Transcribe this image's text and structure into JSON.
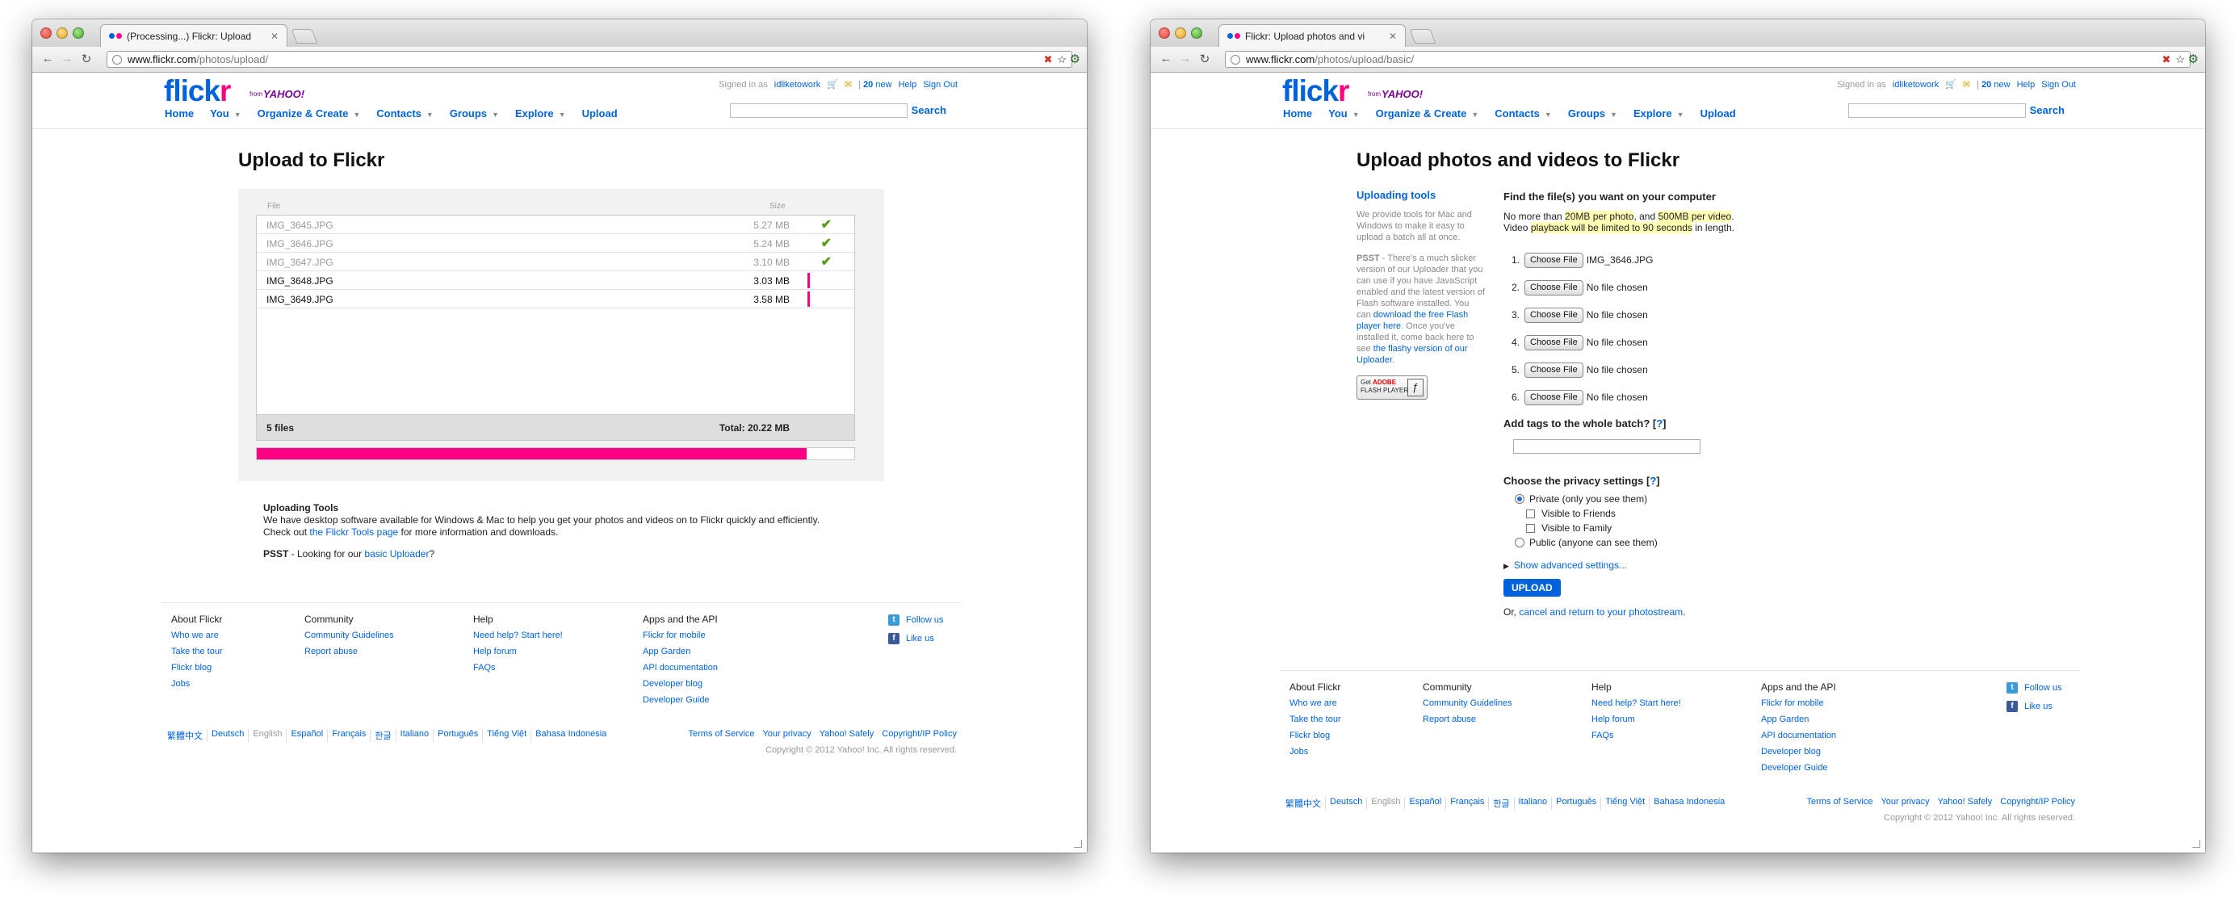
{
  "common": {
    "signed_in_as": "Signed in as",
    "username": "idliketowork",
    "mail_count": "20",
    "mail_new": " new",
    "help": "Help",
    "sign_out": "Sign Out",
    "search_label": "Search",
    "logo_flick": "flick",
    "logo_r": "r",
    "logo_from": "from",
    "logo_yahoo": "YAHOO!",
    "nav": [
      "Home",
      "You",
      "Organize & Create",
      "Contacts",
      "Groups",
      "Explore",
      "Upload"
    ],
    "footer": {
      "columns": [
        {
          "title": "About Flickr",
          "links": [
            "Who we are",
            "Take the tour",
            "Flickr blog",
            "Jobs"
          ]
        },
        {
          "title": "Community",
          "links": [
            "Community Guidelines",
            "Report abuse"
          ]
        },
        {
          "title": "Help",
          "links": [
            "Need help? Start here!",
            "Help forum",
            "FAQs"
          ]
        },
        {
          "title": "Apps and the API",
          "links": [
            "Flickr for mobile",
            "App Garden",
            "API documentation",
            "Developer blog",
            "Developer Guide"
          ]
        }
      ],
      "social": [
        "Follow us",
        "Like us"
      ],
      "languages": [
        "繁體中文",
        "Deutsch",
        "English",
        "Español",
        "Français",
        "한글",
        "Italiano",
        "Português",
        "Tiếng Việt",
        "Bahasa Indonesia"
      ],
      "legal": [
        "Terms of Service",
        "Your privacy",
        "Yahoo! Safely",
        "Copyright/IP Policy"
      ],
      "copyright": "Copyright © 2012 Yahoo! Inc. All rights reserved."
    }
  },
  "left": {
    "tab_title": "(Processing...) Flickr: Upload",
    "url_host": "www.flickr.com",
    "url_path": "/photos/upload/",
    "title": "Upload to Flickr",
    "col_file": "File",
    "col_size": "Size",
    "files": [
      {
        "name": "IMG_3645.JPG",
        "size": "5.27 MB",
        "status": "done"
      },
      {
        "name": "IMG_3646.JPG",
        "size": "5.24 MB",
        "status": "done"
      },
      {
        "name": "IMG_3647.JPG",
        "size": "3.10 MB",
        "status": "done"
      },
      {
        "name": "IMG_3648.JPG",
        "size": "3.03 MB",
        "status": "active"
      },
      {
        "name": "IMG_3649.JPG",
        "size": "3.58 MB",
        "status": "active"
      }
    ],
    "file_count": "5 files",
    "total": "Total: 20.22 MB",
    "progress_fraction": 0.92,
    "tools_heading": "Uploading Tools",
    "tools_text": "We have desktop software available for Windows & Mac to help you get your photos and videos on to Flickr quickly and efficiently.",
    "tools_checkout": "Check out ",
    "tools_link": "the Flickr Tools page",
    "tools_after": " for more information and downloads.",
    "psst_label": "PSST",
    "psst_text": " - Looking for our ",
    "psst_link": "basic Uploader",
    "psst_end": "?"
  },
  "right": {
    "tab_title": "Flickr: Upload photos and vi",
    "url_host": "www.flickr.com",
    "url_path": "/photos/upload/basic/",
    "title": "Upload photos and videos to Flickr",
    "sidebar_heading": "Uploading tools",
    "sidebar_p1": "We provide tools for Mac and Windows to make it easy to upload a batch all at once.",
    "sidebar_psst": "PSST",
    "sidebar_p2a": " - There's a much slicker version of our Uploader that you can use if you have JavaScript enabled and the latest version of Flash software installed. You can ",
    "sidebar_link1": "download the free Flash player here",
    "sidebar_p2b": ". Once you've installed it, come back here to see ",
    "sidebar_link2": "the flashy version of our Uploader",
    "sidebar_p2c": ".",
    "flash_get": "Get",
    "flash_adobe": "ADOBE",
    "flash_player": "FLASH PLAYER",
    "find_heading": "Find the file(s) you want on your computer",
    "limit_1": "No more than ",
    "limit_2": "20MB per photo",
    "limit_3": ", and ",
    "limit_4": "500MB per video",
    "limit_5": ".",
    "limit_6": "Video ",
    "limit_7": "playback will be limited to 90 seconds",
    "limit_8": " in length.",
    "choose_label": "Choose File",
    "file_slots": [
      {
        "num": "1.",
        "value": "IMG_3646.JPG"
      },
      {
        "num": "2.",
        "value": "No file chosen"
      },
      {
        "num": "3.",
        "value": "No file chosen"
      },
      {
        "num": "4.",
        "value": "No file chosen"
      },
      {
        "num": "5.",
        "value": "No file chosen"
      },
      {
        "num": "6.",
        "value": "No file chosen"
      }
    ],
    "tags_heading": "Add tags to the whole batch? [",
    "tags_q": "?",
    "tags_close": "]",
    "privacy_heading": "Choose the privacy settings [",
    "privacy_q": "?",
    "privacy_close": "]",
    "privacy_options": [
      "Private (only you see them)",
      "Visible to Friends",
      "Visible to Family",
      "Public (anyone can see them)"
    ],
    "advanced": "Show advanced settings...",
    "upload_button": "UPLOAD",
    "cancel_prefix": "Or, ",
    "cancel_link": "cancel and return to your photostream",
    "cancel_suffix": "."
  }
}
